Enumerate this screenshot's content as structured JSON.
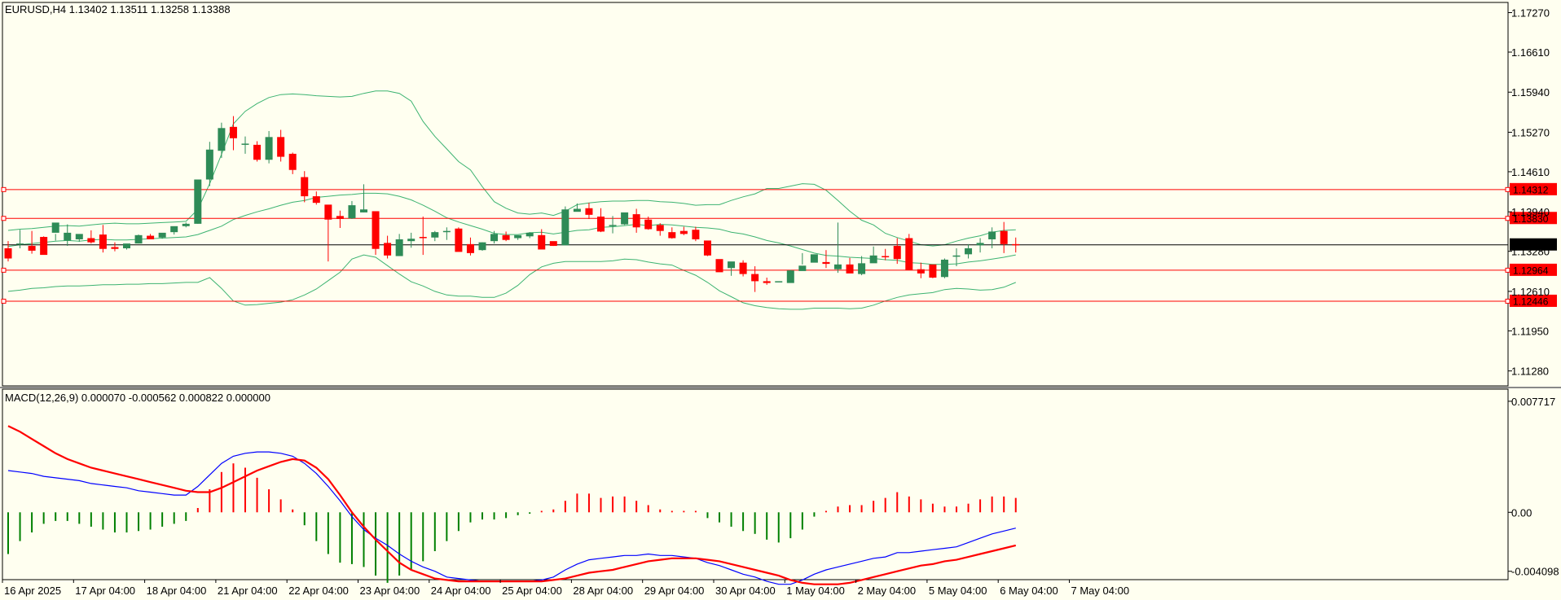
{
  "chart_data": {
    "type": "candlestick",
    "main": {
      "header": "EURUSD,H4  1.13402 1.13511 1.13258 1.13388",
      "price_ticks": [
        "1.17270",
        "1.16610",
        "1.15940",
        "1.15270",
        "1.14610",
        "1.13940",
        "1.13280",
        "1.12610",
        "1.11950",
        "1.11280"
      ],
      "price_tick_values": [
        1.1727,
        1.1661,
        1.1594,
        1.1527,
        1.1461,
        1.1394,
        1.1328,
        1.1261,
        1.1195,
        1.1128
      ],
      "ylim": [
        1.1103,
        1.1744
      ],
      "levels": [
        {
          "label": "1.14312",
          "value": 1.14312
        },
        {
          "label": "1.13830",
          "value": 1.1383
        },
        {
          "label": "1.12964",
          "value": 1.12964
        },
        {
          "label": "1.12446",
          "value": 1.12446
        }
      ],
      "current_price": {
        "label": "1.13388",
        "value": 1.13388
      },
      "candles": [
        [
          1.1333,
          1.1345,
          1.1316,
          1.1311
        ],
        [
          1.1339,
          1.1364,
          1.1341,
          1.1333
        ],
        [
          1.1337,
          1.1362,
          1.1329,
          1.1324
        ],
        [
          1.1352,
          1.1353,
          1.1322,
          1.1337
        ],
        [
          1.1359,
          1.1357,
          1.1376,
          1.1346
        ],
        [
          1.1346,
          1.1373,
          1.1359,
          1.1337
        ],
        [
          1.1348,
          1.1351,
          1.1357,
          1.1344
        ],
        [
          1.135,
          1.1363,
          1.1343,
          1.1341
        ],
        [
          1.1356,
          1.1372,
          1.1332,
          1.1326
        ],
        [
          1.1335,
          1.1343,
          1.1332,
          1.1328
        ],
        [
          1.1333,
          1.1338,
          1.1341,
          1.1331
        ],
        [
          1.1341,
          1.1356,
          1.1355,
          1.1341
        ],
        [
          1.1354,
          1.1357,
          1.1348,
          1.1349
        ],
        [
          1.1351,
          1.1352,
          1.1359,
          1.1349
        ],
        [
          1.136,
          1.1366,
          1.137,
          1.1356
        ],
        [
          1.137,
          1.1376,
          1.1374,
          1.1368
        ],
        [
          1.1374,
          1.1448,
          1.1448,
          1.1374
        ],
        [
          1.1448,
          1.1511,
          1.1498,
          1.1437
        ],
        [
          1.1496,
          1.1543,
          1.1534,
          1.1484
        ],
        [
          1.1536,
          1.1554,
          1.1517,
          1.1497
        ],
        [
          1.1507,
          1.152,
          1.1508,
          1.1491
        ],
        [
          1.1506,
          1.1512,
          1.1481,
          1.1478
        ],
        [
          1.1481,
          1.1529,
          1.1519,
          1.1475
        ],
        [
          1.1519,
          1.1531,
          1.1486,
          1.1478
        ],
        [
          1.1491,
          1.1493,
          1.1464,
          1.1457
        ],
        [
          1.1452,
          1.1462,
          1.142,
          1.141
        ],
        [
          1.142,
          1.1428,
          1.1409,
          1.1406
        ],
        [
          1.1406,
          1.14,
          1.1381,
          1.1311
        ],
        [
          1.1387,
          1.1396,
          1.1382,
          1.1367
        ],
        [
          1.1383,
          1.1412,
          1.1405,
          1.1382
        ],
        [
          1.1393,
          1.144,
          1.1398,
          1.1393
        ],
        [
          1.1395,
          1.1389,
          1.1332,
          1.1322
        ],
        [
          1.1342,
          1.1354,
          1.1321,
          1.1316
        ],
        [
          1.132,
          1.1357,
          1.1348,
          1.1322
        ],
        [
          1.1345,
          1.1359,
          1.1349,
          1.1334
        ],
        [
          1.1352,
          1.1386,
          1.1351,
          1.1322
        ],
        [
          1.1351,
          1.1362,
          1.136,
          1.1345
        ],
        [
          1.1361,
          1.1368,
          1.1362,
          1.1347
        ],
        [
          1.1366,
          1.1368,
          1.1327,
          1.1336
        ],
        [
          1.134,
          1.1351,
          1.1325,
          1.1321
        ],
        [
          1.133,
          1.1343,
          1.1343,
          1.1329
        ],
        [
          1.1345,
          1.1362,
          1.1357,
          1.1341
        ],
        [
          1.1355,
          1.1361,
          1.1347,
          1.1345
        ],
        [
          1.135,
          1.1354,
          1.1355,
          1.1347
        ],
        [
          1.1353,
          1.136,
          1.1359,
          1.135
        ],
        [
          1.1355,
          1.1365,
          1.1331,
          1.1334
        ],
        [
          1.1345,
          1.1342,
          1.1337,
          1.1337
        ],
        [
          1.1338,
          1.1403,
          1.1398,
          1.1339
        ],
        [
          1.1394,
          1.1408,
          1.1399,
          1.1396
        ],
        [
          1.14,
          1.1409,
          1.1389,
          1.1382
        ],
        [
          1.1386,
          1.14,
          1.1361,
          1.136
        ],
        [
          1.1371,
          1.1387,
          1.1372,
          1.1358
        ],
        [
          1.1373,
          1.1391,
          1.1393,
          1.1372
        ],
        [
          1.139,
          1.1399,
          1.1368,
          1.1359
        ],
        [
          1.1381,
          1.1386,
          1.1365,
          1.1364
        ],
        [
          1.1372,
          1.1375,
          1.1362,
          1.1354
        ],
        [
          1.136,
          1.1368,
          1.135,
          1.1349
        ],
        [
          1.1362,
          1.1369,
          1.1357,
          1.1355
        ],
        [
          1.1364,
          1.1369,
          1.1348,
          1.1345
        ],
        [
          1.1346,
          1.1344,
          1.1321,
          1.132
        ],
        [
          1.1315,
          1.1313,
          1.1293,
          1.1294
        ],
        [
          1.13,
          1.1307,
          1.1311,
          1.1287
        ],
        [
          1.1309,
          1.1313,
          1.129,
          1.1286
        ],
        [
          1.129,
          1.1303,
          1.1278,
          1.126
        ],
        [
          1.1278,
          1.1284,
          1.1275,
          1.1272
        ],
        [
          1.1276,
          1.1273,
          1.1278,
          1.1273
        ],
        [
          1.1275,
          1.1297,
          1.1296,
          1.1279
        ],
        [
          1.1295,
          1.1325,
          1.1304,
          1.1306
        ],
        [
          1.1309,
          1.132,
          1.1323,
          1.131
        ],
        [
          1.131,
          1.133,
          1.1307,
          1.13
        ],
        [
          1.1298,
          1.1376,
          1.1306,
          1.1292
        ],
        [
          1.1306,
          1.1317,
          1.1291,
          1.1294
        ],
        [
          1.129,
          1.132,
          1.1308,
          1.1288
        ],
        [
          1.1308,
          1.1336,
          1.1321,
          1.1309
        ],
        [
          1.132,
          1.1332,
          1.1319,
          1.1313
        ],
        [
          1.1337,
          1.135,
          1.1315,
          1.1307
        ],
        [
          1.135,
          1.1357,
          1.1297,
          1.1297
        ],
        [
          1.1298,
          1.1309,
          1.1291,
          1.1283
        ],
        [
          1.1306,
          1.1294,
          1.1284,
          1.1283
        ],
        [
          1.1285,
          1.1316,
          1.1314,
          1.1283
        ],
        [
          1.132,
          1.1333,
          1.1321,
          1.1303
        ],
        [
          1.1323,
          1.134,
          1.1333,
          1.1316
        ],
        [
          1.1338,
          1.135,
          1.1342,
          1.1326
        ],
        [
          1.1348,
          1.1368,
          1.1361,
          1.1333
        ],
        [
          1.1362,
          1.1377,
          1.134,
          1.1325
        ],
        [
          1.134,
          1.1351,
          1.1339,
          1.1326
        ]
      ],
      "candle_fields": [
        "open",
        "high",
        "close",
        "low"
      ],
      "bollinger": {
        "upper": [
          1.1363,
          1.1365,
          1.1366,
          1.1368,
          1.137,
          1.1371,
          1.137,
          1.1372,
          1.1374,
          1.1375,
          1.1374,
          1.1374,
          1.1375,
          1.1376,
          1.1377,
          1.1378,
          1.1398,
          1.1441,
          1.149,
          1.1541,
          1.1562,
          1.1575,
          1.1585,
          1.159,
          1.1591,
          1.159,
          1.1588,
          1.1587,
          1.1586,
          1.1587,
          1.1592,
          1.1596,
          1.1596,
          1.1592,
          1.1579,
          1.1545,
          1.152,
          1.1499,
          1.1478,
          1.1464,
          1.1436,
          1.1411,
          1.14,
          1.1392,
          1.139,
          1.1392,
          1.1388,
          1.1395,
          1.1406,
          1.1409,
          1.1411,
          1.1412,
          1.1412,
          1.1413,
          1.1413,
          1.1411,
          1.141,
          1.1408,
          1.1405,
          1.1406,
          1.1406,
          1.1413,
          1.1419,
          1.1424,
          1.1433,
          1.1433,
          1.1437,
          1.1441,
          1.144,
          1.143,
          1.1413,
          1.1395,
          1.138,
          1.1372,
          1.1358,
          1.1351,
          1.1345,
          1.1339,
          1.1337,
          1.1339,
          1.1345,
          1.135,
          1.1354,
          1.136,
          1.1363,
          1.1364
        ],
        "middle": [
          1.1336,
          1.1339,
          1.1341,
          1.1343,
          1.1345,
          1.1346,
          1.1345,
          1.1347,
          1.1348,
          1.1347,
          1.1347,
          1.1348,
          1.1349,
          1.135,
          1.1351,
          1.1352,
          1.1356,
          1.1363,
          1.137,
          1.1381,
          1.1388,
          1.1394,
          1.1399,
          1.1405,
          1.141,
          1.1413,
          1.1418,
          1.142,
          1.1422,
          1.1423,
          1.1425,
          1.1425,
          1.1424,
          1.142,
          1.1414,
          1.1405,
          1.1395,
          1.1384,
          1.1377,
          1.1371,
          1.1365,
          1.1358,
          1.1356,
          1.1356,
          1.1359,
          1.136,
          1.1357,
          1.136,
          1.1363,
          1.1364,
          1.1368,
          1.1369,
          1.1371,
          1.1373,
          1.1371,
          1.1373,
          1.1372,
          1.137,
          1.1368,
          1.1367,
          1.1365,
          1.136,
          1.1357,
          1.1352,
          1.1346,
          1.1342,
          1.1337,
          1.1331,
          1.1325,
          1.1321,
          1.132,
          1.1318,
          1.1317,
          1.1316,
          1.1314,
          1.1313,
          1.1309,
          1.1308,
          1.1306,
          1.1306,
          1.1307,
          1.131,
          1.1312,
          1.1315,
          1.1318,
          1.1322
        ],
        "lower": [
          1.1261,
          1.1263,
          1.1266,
          1.1267,
          1.1269,
          1.127,
          1.127,
          1.1271,
          1.1272,
          1.1272,
          1.1273,
          1.1273,
          1.1274,
          1.1274,
          1.1275,
          1.1276,
          1.1276,
          1.1284,
          1.1266,
          1.1245,
          1.1238,
          1.1239,
          1.1241,
          1.1243,
          1.1247,
          1.1255,
          1.1265,
          1.1279,
          1.1293,
          1.1315,
          1.1322,
          1.1318,
          1.1304,
          1.129,
          1.1277,
          1.127,
          1.1261,
          1.1255,
          1.1253,
          1.1253,
          1.1251,
          1.1251,
          1.1258,
          1.1271,
          1.1289,
          1.1302,
          1.1308,
          1.1311,
          1.1311,
          1.1311,
          1.1311,
          1.1312,
          1.1315,
          1.1314,
          1.131,
          1.1307,
          1.1305,
          1.1296,
          1.1288,
          1.1276,
          1.1262,
          1.1252,
          1.1242,
          1.1237,
          1.1234,
          1.1232,
          1.1231,
          1.1231,
          1.1233,
          1.1233,
          1.1233,
          1.1232,
          1.1233,
          1.1238,
          1.1245,
          1.1251,
          1.1255,
          1.1257,
          1.1259,
          1.1264,
          1.1266,
          1.1265,
          1.1263,
          1.1264,
          1.1268,
          1.1276
        ]
      }
    },
    "macd": {
      "header": "MACD(12,26,9) 0.000070 -0.000562 0.000822 0.000000",
      "ticks": [
        "0.007717",
        "0.00",
        "-0.004098"
      ],
      "tick_values": [
        0.007717,
        0,
        -0.004098
      ],
      "ylim": [
        -0.00468,
        0.00856
      ],
      "histogram": [
        -0.0029,
        -0.002,
        -0.0014,
        -0.0008,
        -0.0006,
        -0.0006,
        -0.0008,
        -0.001,
        -0.0012,
        -0.0014,
        -0.0014,
        -0.0013,
        -0.0012,
        -0.001,
        -0.0008,
        -0.0006,
        0.0003,
        0.0016,
        0.0028,
        0.0034,
        0.0031,
        0.0024,
        0.0016,
        0.0009,
        0.0002,
        -0.0009,
        -0.002,
        -0.0029,
        -0.0035,
        -0.0036,
        -0.0038,
        -0.0044,
        -0.0049,
        -0.0044,
        -0.004,
        -0.0034,
        -0.0027,
        -0.002,
        -0.0013,
        -0.0007,
        -0.0005,
        -0.0005,
        -0.0004,
        -0.0002,
        -0.0001,
        0.0001,
        0.0002,
        0.0008,
        0.0013,
        0.0013,
        0.001,
        0.0011,
        0.0011,
        0.0008,
        0.0005,
        0.0002,
        0.0001,
        0.0001,
        0.0001,
        -0.0004,
        -0.0007,
        -0.001,
        -0.0013,
        -0.0015,
        -0.0019,
        -0.0021,
        -0.0018,
        -0.0012,
        -0.0003,
        0.0001,
        0.0004,
        0.0005,
        0.0005,
        0.0008,
        0.001,
        0.0014,
        0.0011,
        0.0009,
        0.0006,
        0.0004,
        0.0004,
        0.0006,
        0.0009,
        0.0011,
        0.0011,
        0.001
      ],
      "macd_line": [
        0.0029,
        0.0028,
        0.0027,
        0.0025,
        0.0024,
        0.0023,
        0.0022,
        0.002,
        0.0019,
        0.0018,
        0.0017,
        0.0015,
        0.0014,
        0.0013,
        0.0012,
        0.0012,
        0.0018,
        0.0026,
        0.0034,
        0.0039,
        0.0041,
        0.0042,
        0.0042,
        0.0041,
        0.0039,
        0.0034,
        0.0027,
        0.0018,
        0.0008,
        -0.0003,
        -0.0012,
        -0.0018,
        -0.0023,
        -0.0029,
        -0.0034,
        -0.0038,
        -0.0041,
        -0.0045,
        -0.0046,
        -0.0047,
        -0.0048,
        -0.0048,
        -0.0048,
        -0.0048,
        -0.0048,
        -0.0047,
        -0.0045,
        -0.004,
        -0.0036,
        -0.0033,
        -0.0032,
        -0.0031,
        -0.003,
        -0.003,
        -0.0029,
        -0.003,
        -0.003,
        -0.0031,
        -0.0032,
        -0.0035,
        -0.0037,
        -0.004,
        -0.0043,
        -0.0045,
        -0.0048,
        -0.005,
        -0.005,
        -0.0047,
        -0.0043,
        -0.004,
        -0.0038,
        -0.0036,
        -0.0034,
        -0.0032,
        -0.0031,
        -0.0028,
        -0.0028,
        -0.0027,
        -0.0026,
        -0.0025,
        -0.0024,
        -0.0021,
        -0.0018,
        -0.0015,
        -0.0013,
        -0.0011
      ],
      "signal_line": [
        0.006,
        0.0056,
        0.0051,
        0.0046,
        0.0041,
        0.0037,
        0.0034,
        0.0031,
        0.0029,
        0.0027,
        0.0025,
        0.0023,
        0.0021,
        0.0019,
        0.0017,
        0.0015,
        0.0014,
        0.0014,
        0.0017,
        0.0021,
        0.0025,
        0.0029,
        0.0032,
        0.0035,
        0.0037,
        0.0036,
        0.0031,
        0.0023,
        0.0012,
        0.0,
        -0.001,
        -0.0019,
        -0.0027,
        -0.0035,
        -0.004,
        -0.0043,
        -0.0046,
        -0.0047,
        -0.0048,
        -0.0048,
        -0.0048,
        -0.0048,
        -0.0048,
        -0.0048,
        -0.0048,
        -0.0048,
        -0.0047,
        -0.0046,
        -0.0044,
        -0.0042,
        -0.0041,
        -0.004,
        -0.0038,
        -0.0036,
        -0.0034,
        -0.0033,
        -0.0032,
        -0.0032,
        -0.0032,
        -0.0033,
        -0.0034,
        -0.0036,
        -0.0038,
        -0.004,
        -0.0042,
        -0.0044,
        -0.0047,
        -0.0049,
        -0.005,
        -0.005,
        -0.005,
        -0.0049,
        -0.0047,
        -0.0045,
        -0.0043,
        -0.0041,
        -0.0039,
        -0.0037,
        -0.0036,
        -0.0034,
        -0.0033,
        -0.0031,
        -0.0029,
        -0.0027,
        -0.0025,
        -0.0023
      ]
    },
    "x_labels": [
      "16 Apr 2025",
      "17 Apr 04:00",
      "18 Apr 04:00",
      "21 Apr 04:00",
      "22 Apr 04:00",
      "23 Apr 04:00",
      "24 Apr 04:00",
      "25 Apr 04:00",
      "28 Apr 04:00",
      "29 Apr 04:00",
      "30 Apr 04:00",
      "1 May 04:00",
      "2 May 04:00",
      "5 May 04:00",
      "6 May 04:00",
      "7 May 04:00"
    ],
    "x_label_bar_index": [
      0,
      6,
      12,
      18,
      24,
      30,
      36,
      42,
      48,
      54,
      60,
      66,
      72,
      78,
      84,
      90
    ],
    "colors": {
      "background": "#fffff0",
      "bull": "#2e8b57",
      "bear": "#ff0000",
      "bollinger": "#3cb371",
      "level_line": "#ff0000",
      "macd_line": "#0000ff",
      "signal_line": "#ff0000",
      "hist_pos": "#ff0000",
      "hist_neg": "#008000"
    }
  }
}
